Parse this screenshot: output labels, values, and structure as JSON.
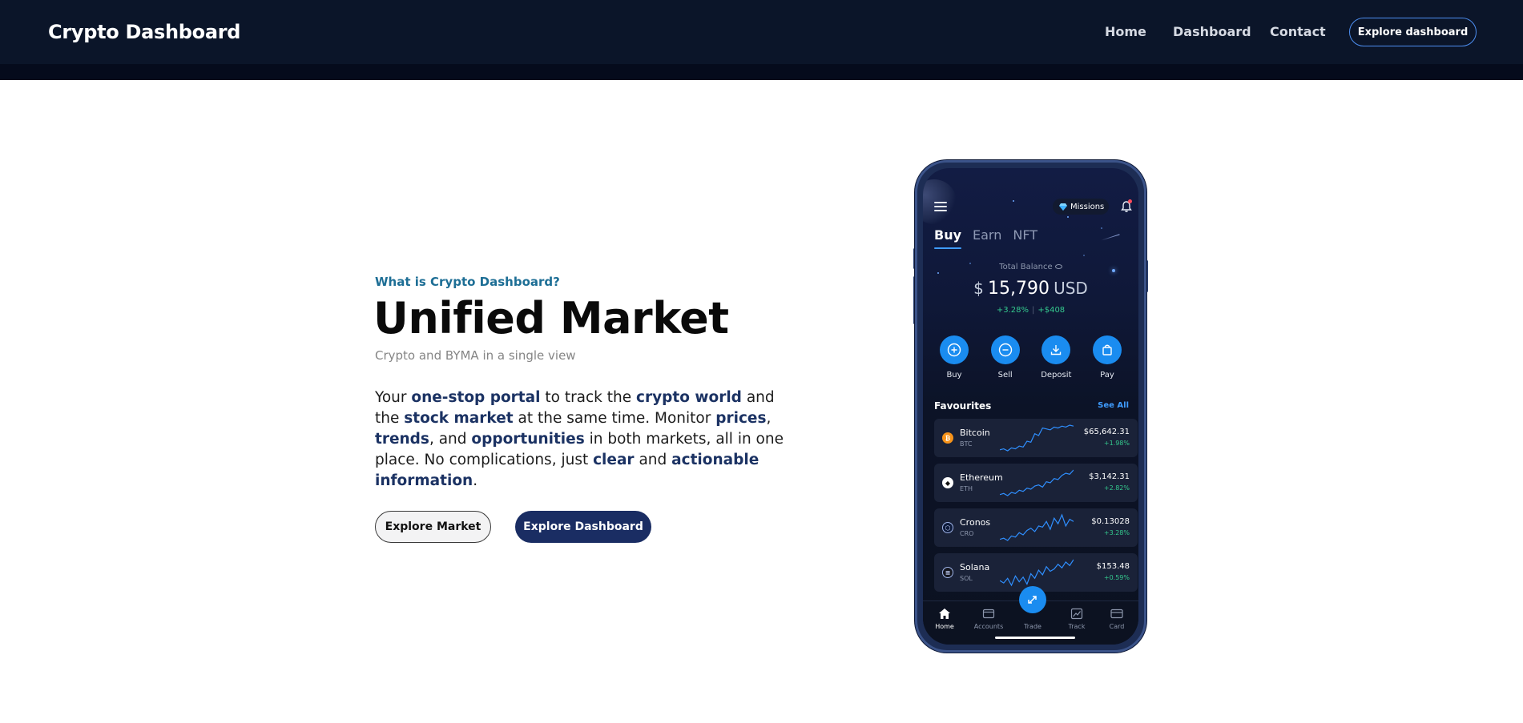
{
  "header": {
    "brand": "Crypto Dashboard",
    "nav": [
      "Home",
      "Dashboard",
      "Contact"
    ],
    "cta_label": "Explore dashboard"
  },
  "hero": {
    "eyebrow": "What is Crypto Dashboard?",
    "title": "Unified Market",
    "subtitle": "Crypto and BYMA in a single view",
    "body": {
      "t1": "Your ",
      "b1": "one-stop portal",
      "t2": " to track the ",
      "b2": "crypto world",
      "t3": " and the ",
      "b3": "stock market",
      "t4": " at the same time. Monitor ",
      "b4": "prices",
      "t5": ", ",
      "b5": "trends",
      "t6": ", and ",
      "b6": "opportunities",
      "t7": " in both markets, all in one place. No complications, just ",
      "b7": "clear",
      "t8": " and ",
      "b8": "actionable information",
      "t9": "."
    },
    "buttons": {
      "market": "Explore Market",
      "dashboard": "Explore Dashboard"
    }
  },
  "phone": {
    "missions_label": "Missions",
    "tabs": [
      "Buy",
      "Earn",
      "NFT"
    ],
    "balance": {
      "label": "Total Balance",
      "currency_symbol": "$",
      "amount": "15,790",
      "currency_code": "USD",
      "change_pct": "+3.28%",
      "change_abs": "+$408"
    },
    "actions": [
      "Buy",
      "Sell",
      "Deposit",
      "Pay"
    ],
    "favourites_title": "Favourites",
    "see_all": "See All",
    "coins": [
      {
        "name": "Bitcoin",
        "symbol": "BTC",
        "price": "$65,642.31",
        "change": "+1.98%",
        "icon_color": "#f7931a",
        "icon_glyph": "₿",
        "spark": [
          5,
          6,
          4,
          7,
          6,
          9,
          8,
          14,
          13,
          22,
          20,
          28,
          27,
          26,
          29,
          28,
          30,
          29,
          31,
          30
        ]
      },
      {
        "name": "Ethereum",
        "symbol": "ETH",
        "price": "$3,142.31",
        "change": "+2.82%",
        "icon_color": "#ffffff",
        "icon_glyph": "◆",
        "spark": [
          4,
          5,
          3,
          6,
          5,
          8,
          7,
          10,
          9,
          12,
          13,
          11,
          16,
          15,
          19,
          18,
          22,
          24,
          23,
          27
        ]
      },
      {
        "name": "Cronos",
        "symbol": "CRO",
        "price": "$0.13028",
        "change": "+3.28%",
        "icon_color": "#0d1a3a",
        "icon_glyph": "⬡",
        "spark": [
          6,
          7,
          5,
          9,
          8,
          12,
          10,
          14,
          16,
          13,
          18,
          17,
          22,
          15,
          25,
          20,
          28,
          18,
          24,
          22
        ]
      },
      {
        "name": "Solana",
        "symbol": "SOL",
        "price": "$153.48",
        "change": "+0.59%",
        "icon_color": "#14161f",
        "icon_glyph": "≡",
        "spark": [
          10,
          8,
          12,
          6,
          14,
          9,
          13,
          7,
          16,
          12,
          19,
          15,
          22,
          18,
          20,
          24,
          21,
          26,
          23,
          28
        ]
      }
    ],
    "bottom_nav": [
      "Home",
      "Accounts",
      "Trade",
      "Track",
      "Card"
    ]
  }
}
